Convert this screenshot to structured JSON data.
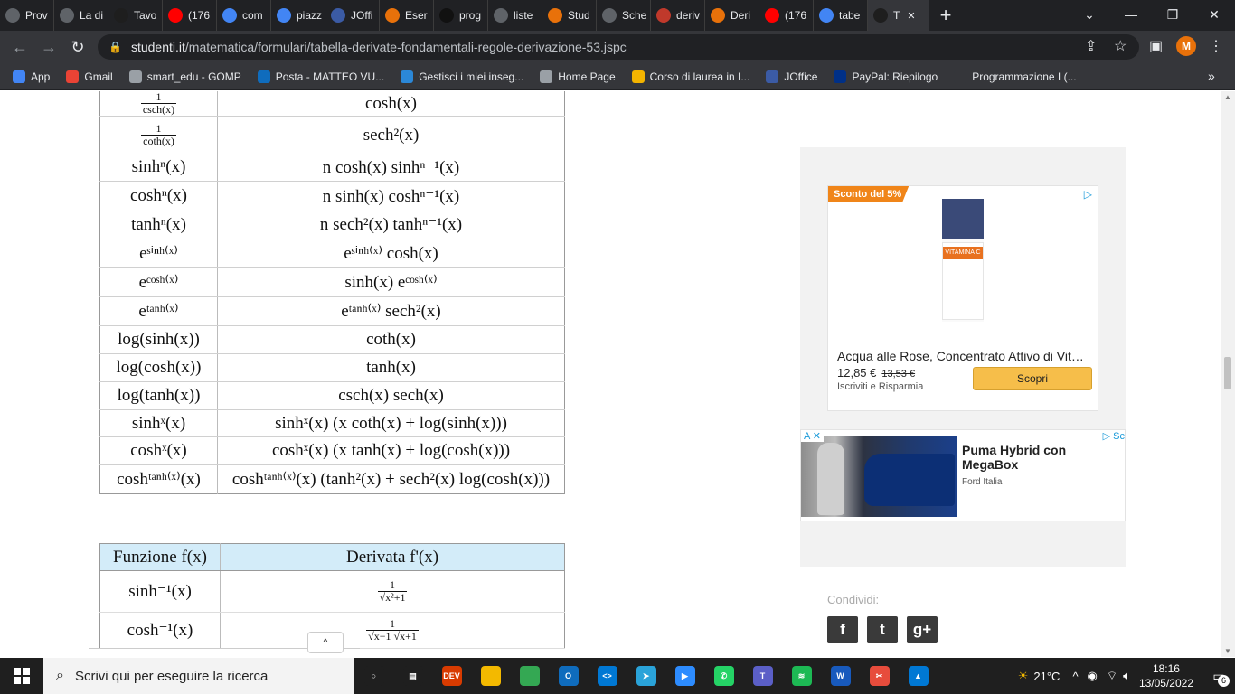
{
  "browser": {
    "tabs": [
      {
        "label": "Prov",
        "icon": "generic-tab-icon",
        "color": "#5f6368"
      },
      {
        "label": "La di",
        "icon": "chrome-globe-icon",
        "color": "#5f6368"
      },
      {
        "label": "Tavo",
        "icon": "studenti-s-icon",
        "color": "#1e1e1e"
      },
      {
        "label": "(176",
        "icon": "youtube-icon",
        "color": "#ff0000"
      },
      {
        "label": "com",
        "icon": "google-icon",
        "color": "#4285f4"
      },
      {
        "label": "piazz",
        "icon": "google-icon",
        "color": "#4285f4"
      },
      {
        "label": "JOffi",
        "icon": "joffice-icon",
        "color": "#3b5ba5"
      },
      {
        "label": "Eser",
        "icon": "youmath-pi-icon",
        "color": "#e8710a"
      },
      {
        "label": "prog",
        "icon": "github-icon",
        "color": "#111111"
      },
      {
        "label": "liste",
        "icon": "chrome-globe-icon",
        "color": "#5f6368"
      },
      {
        "label": "Stud",
        "icon": "youmath-pi-icon",
        "color": "#e8710a"
      },
      {
        "label": "Sche",
        "icon": "chrome-globe-icon",
        "color": "#5f6368"
      },
      {
        "label": "deriv",
        "icon": "university-icon",
        "color": "#c0392b"
      },
      {
        "label": "Deri",
        "icon": "youmath-pi-icon",
        "color": "#e8710a"
      },
      {
        "label": "(176",
        "icon": "youtube-icon",
        "color": "#ff0000"
      },
      {
        "label": "tabe",
        "icon": "google-icon",
        "color": "#4285f4"
      },
      {
        "label": "T",
        "icon": "studenti-s-icon",
        "color": "#1e1e1e",
        "active": true
      }
    ],
    "new_tab": "+",
    "url_host": "studenti.it",
    "url_path": "/matematica/formulari/tabella-derivate-fondamentali-regole-derivazione-53.jspc",
    "profile_initial": "M",
    "bookmarks": [
      {
        "label": "App",
        "color": "#4285f4"
      },
      {
        "label": "Gmail",
        "color": "#ea4335"
      },
      {
        "label": "smart_edu - GOMP",
        "color": "#9aa0a6"
      },
      {
        "label": "Posta - MATTEO VU...",
        "color": "#0f6cbd"
      },
      {
        "label": "Gestisci i miei inseg...",
        "color": "#2b88d8"
      },
      {
        "label": "Home Page",
        "color": "#9aa0a6"
      },
      {
        "label": "Corso di laurea in I...",
        "color": "#f4b400"
      },
      {
        "label": "JOffice",
        "color": "#3b5ba5"
      },
      {
        "label": "PayPal: Riepilogo",
        "color": "#003087"
      },
      {
        "label": "Programmazione I (...",
        "color": "#35363a"
      }
    ],
    "bookmarks_overflow": "»"
  },
  "table1": {
    "rows": [
      {
        "f": {
          "type": "frac",
          "num": "1",
          "den": "csch(x)"
        },
        "d": "cosh(x)",
        "sep": true
      },
      {
        "f": {
          "type": "frac",
          "num": "1",
          "den": "coth(x)"
        },
        "d": "sech²(x)",
        "sep": false
      },
      {
        "f": "sinhⁿ(x)",
        "d": "n cosh(x) sinhⁿ⁻¹(x)",
        "sep": true
      },
      {
        "f": "coshⁿ(x)",
        "d": "n sinh(x) coshⁿ⁻¹(x)",
        "sep": false
      },
      {
        "f": "tanhⁿ(x)",
        "d": "n sech²(x) tanhⁿ⁻¹(x)",
        "sep": true
      },
      {
        "f": "eˢⁱⁿʰ⁽ˣ⁾",
        "d": "eˢⁱⁿʰ⁽ˣ⁾ cosh(x)",
        "sep": true
      },
      {
        "f": "eᶜᵒˢʰ⁽ˣ⁾",
        "d": "sinh(x) eᶜᵒˢʰ⁽ˣ⁾",
        "sep": true
      },
      {
        "f": "eᵗᵃⁿʰ⁽ˣ⁾",
        "d": "eᵗᵃⁿʰ⁽ˣ⁾ sech²(x)",
        "sep": true
      },
      {
        "f": "log(sinh(x))",
        "d": "coth(x)",
        "sep": true
      },
      {
        "f": "log(cosh(x))",
        "d": "tanh(x)",
        "sep": true
      },
      {
        "f": "log(tanh(x))",
        "d": "csch(x) sech(x)",
        "sep": true
      },
      {
        "f": "sinhˣ(x)",
        "d": "sinhˣ(x) (x coth(x) + log(sinh(x)))",
        "sep": true
      },
      {
        "f": "coshˣ(x)",
        "d": "coshˣ(x) (x tanh(x) + log(cosh(x)))",
        "sep": true
      },
      {
        "f": "coshᵗᵃⁿʰ⁽ˣ⁾(x)",
        "d": "coshᵗᵃⁿʰ⁽ˣ⁾(x) (tanh²(x) + sech²(x) log(cosh(x)))",
        "sep": false
      }
    ]
  },
  "table2": {
    "header_f": "Funzione f(x)",
    "header_d": "Derivata f'(x)",
    "rows": [
      {
        "f": "sinh⁻¹(x)",
        "d": {
          "type": "frac",
          "num": "1",
          "den": "√x²+1"
        }
      },
      {
        "f": "cosh⁻¹(x)",
        "d": {
          "type": "frac",
          "num": "1",
          "den": "√x−1 √x+1"
        }
      }
    ]
  },
  "ad1": {
    "badge": "Sconto del 5%",
    "choices_icon": "ad-choices-icon",
    "title": "Acqua alle Rose, Concentrato Attivo di Vitamina C",
    "price": "12,85 €",
    "old_price": "13,53 €",
    "seller": "Iscriviti e Risparmia",
    "cta": "Scopri",
    "product_label": "VITAMINA C"
  },
  "ad2": {
    "headline": "Puma Hybrid con MegaBox",
    "brand": "Ford Italia",
    "close_label": "A",
    "choices_label": "Sc"
  },
  "share": {
    "label": "Condividi:",
    "buttons": [
      "f",
      "t",
      "g+"
    ]
  },
  "scroll_top_label": "^",
  "taskbar": {
    "search_placeholder": "Scrivi qui per eseguire la ricerca",
    "apps": [
      {
        "name": "task-view",
        "color": "#1f1f1f",
        "glyph": "○"
      },
      {
        "name": "widgets",
        "color": "#1f1f1f",
        "glyph": "▤"
      },
      {
        "name": "devcpp",
        "color": "#d83b01",
        "glyph": "DEV"
      },
      {
        "name": "file-explorer",
        "color": "#f3b900",
        "glyph": ""
      },
      {
        "name": "chrome",
        "color": "#34a853",
        "glyph": ""
      },
      {
        "name": "outlook",
        "color": "#0f6cbd",
        "glyph": "O"
      },
      {
        "name": "vscode",
        "color": "#0078d4",
        "glyph": "<>"
      },
      {
        "name": "telegram",
        "color": "#2aa3d9",
        "glyph": "➤"
      },
      {
        "name": "zoom",
        "color": "#2d8cff",
        "glyph": "▶"
      },
      {
        "name": "whatsapp",
        "color": "#25d366",
        "glyph": "✆"
      },
      {
        "name": "teams",
        "color": "#5b5fc7",
        "glyph": "T"
      },
      {
        "name": "spotify",
        "color": "#1db954",
        "glyph": "≋"
      },
      {
        "name": "word",
        "color": "#185abd",
        "glyph": "W"
      },
      {
        "name": "snipping-tool",
        "color": "#e74c3c",
        "glyph": "✂"
      },
      {
        "name": "photos",
        "color": "#0078d4",
        "glyph": "▲"
      }
    ],
    "weather": "21°C",
    "time": "18:16",
    "date": "13/05/2022",
    "notifications": "6"
  }
}
